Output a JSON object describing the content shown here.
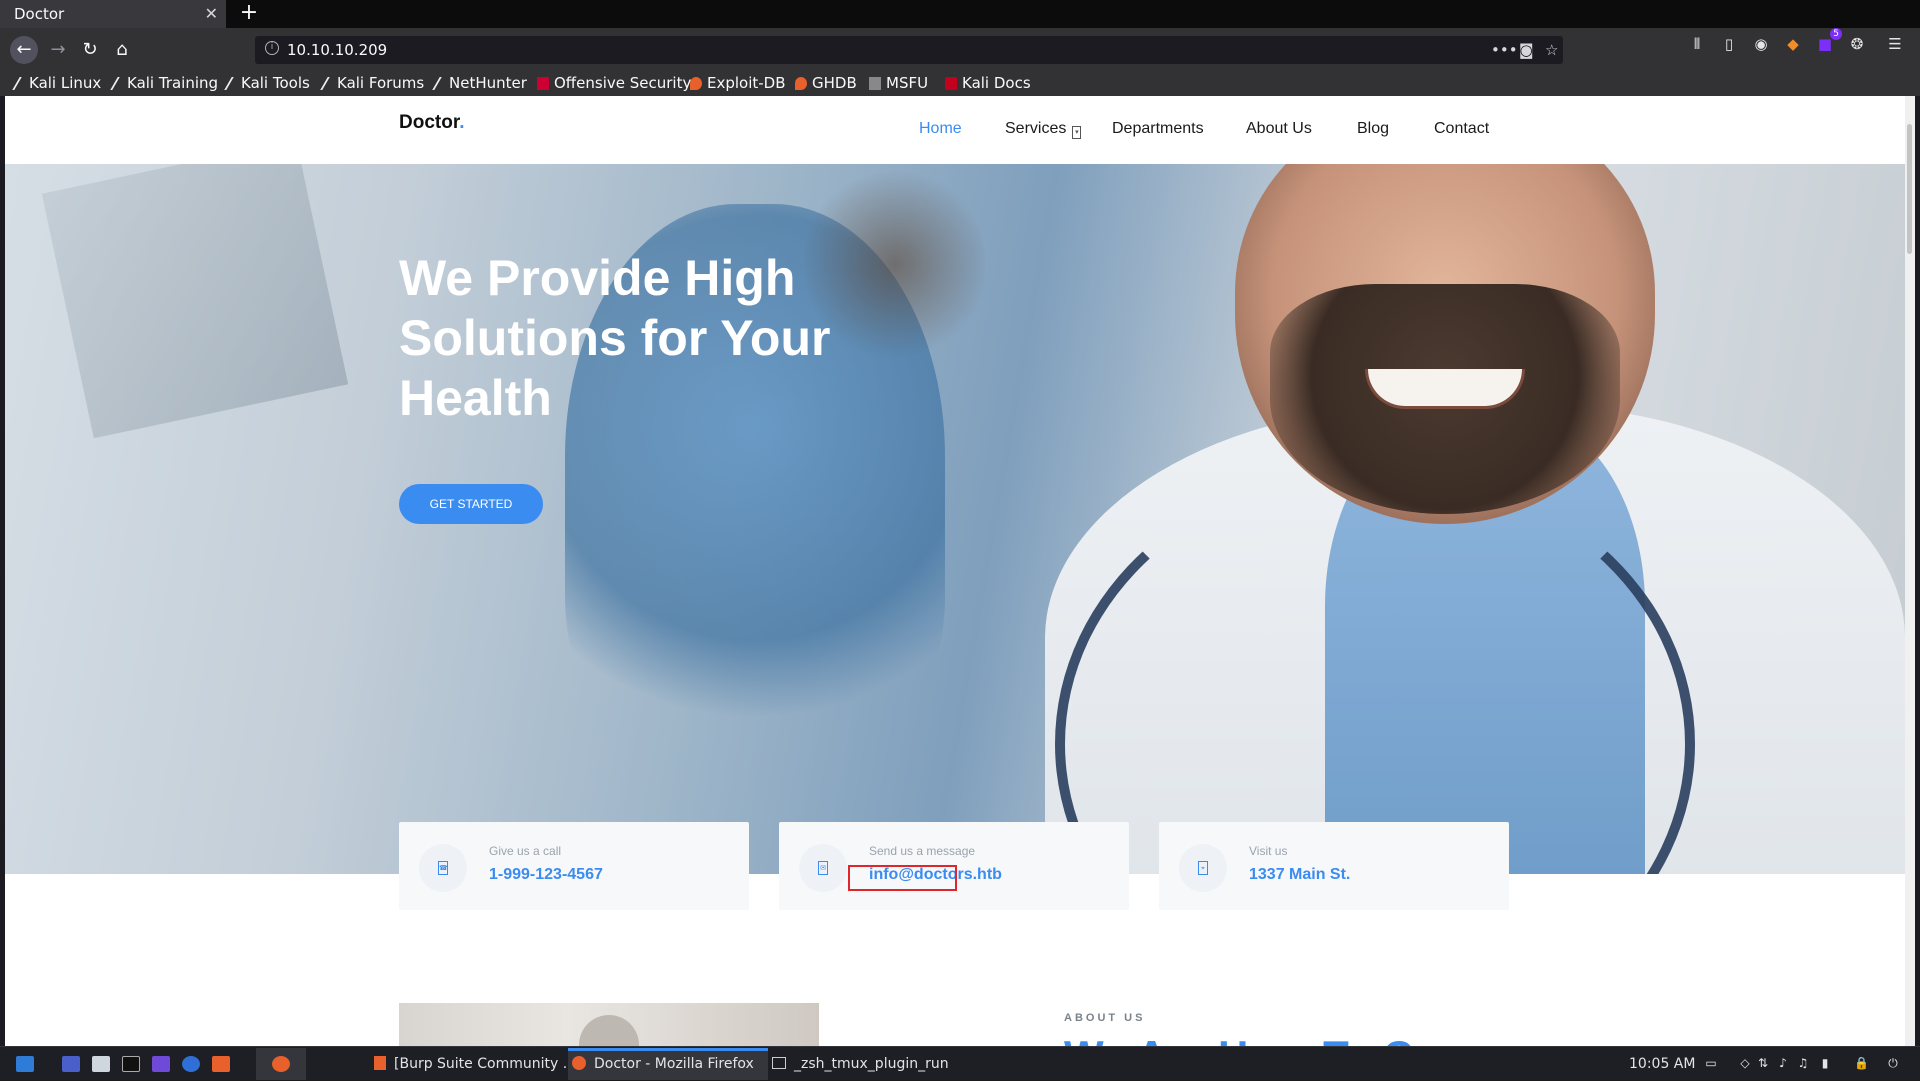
{
  "browser": {
    "tab_title": "Doctor",
    "tab_close": "✕",
    "new_tab": "+",
    "url": "10.10.10.209",
    "toolbar_badge": "5",
    "bookmarks": [
      "Kali Linux",
      "Kali Training",
      "Kali Tools",
      "Kali Forums",
      "NetHunter",
      "Offensive Security",
      "Exploit-DB",
      "GHDB",
      "MSFU",
      "Kali Docs"
    ]
  },
  "site": {
    "logo": "Doctor",
    "logo_dot": ".",
    "nav": [
      "Home",
      "Services",
      "Departments",
      "About Us",
      "Blog",
      "Contact"
    ],
    "active_nav": "Home",
    "hero_title": "We Provide High Solutions for Your Health",
    "cta": "GET STARTED",
    "cards": [
      {
        "label": "Give us a call",
        "value": "1-999-123-4567"
      },
      {
        "label": "Send us a message",
        "value": "info@doctors.htb"
      },
      {
        "label": "Visit us",
        "value": "1337 Main St."
      }
    ],
    "about_kicker": "ABOUT US",
    "about_heading": "We Are Here To Care"
  },
  "taskbar": {
    "windows": [
      "[Burp Suite Community ...",
      "Doctor - Mozilla Firefox",
      "_zsh_tmux_plugin_run"
    ],
    "clock": "10:05 AM"
  },
  "colors": {
    "accent": "#3b8cf0",
    "highlight_box": "#e0262a"
  }
}
